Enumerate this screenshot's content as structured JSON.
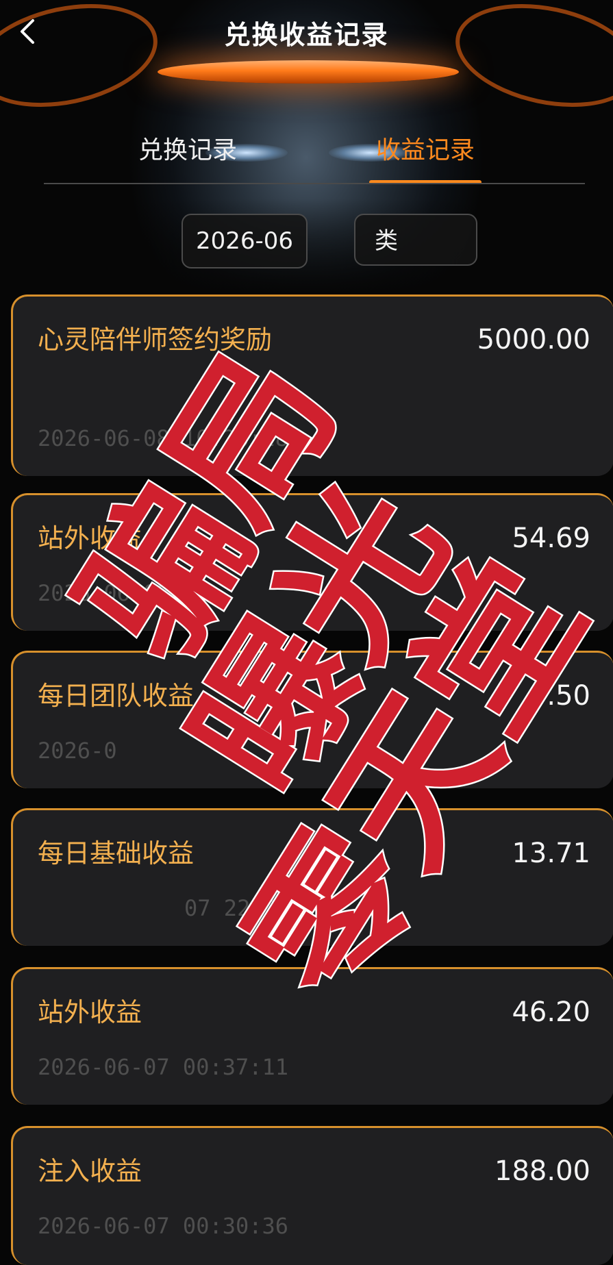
{
  "header": {
    "title": "兑换收益记录",
    "back_icon": "chevron-left-icon"
  },
  "tabs": [
    {
      "label": "兑换记录",
      "active": false
    },
    {
      "label": "收益记录",
      "active": true
    }
  ],
  "filters": {
    "date": "2026-06",
    "type": "类"
  },
  "records": [
    {
      "name": "心灵陪伴师签约奖励",
      "amount": "5000.00",
      "time": "2026-06-08 10:28:28"
    },
    {
      "name": "站外收益",
      "amount": "54.69",
      "time": "2026-06-08 00:"
    },
    {
      "name": "每日团队收益",
      "amount": "9.50",
      "time": "2026-0"
    },
    {
      "name": "每日基础收益",
      "amount": "13.71",
      "time": "07 22:21"
    },
    {
      "name": "站外收益",
      "amount": "46.20",
      "time": "2026-06-07 00:37:11"
    },
    {
      "name": "注入收益",
      "amount": "188.00",
      "time": "2026-06-07 00:30:36"
    }
  ],
  "watermark": {
    "text": "骗局 曝光 零天堂",
    "color": "#d0202e"
  }
}
